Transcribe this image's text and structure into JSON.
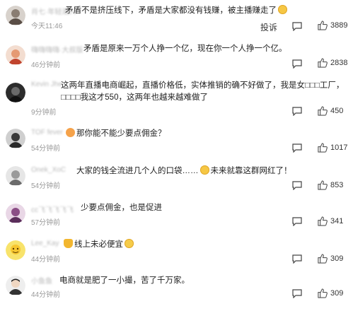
{
  "comments": [
    {
      "user": "肖七·年轻潮人",
      "text_before": "矛盾不是挤压线下，矛盾是大家都没有钱赚，被主播赚走了",
      "emoji_after": "sly-emoji",
      "time": "今天11:46",
      "reply": "投诉",
      "likes": "3889"
    },
    {
      "user": "嗨嗨嗨嗨·大叔版",
      "text_before": "矛盾是原来一万个人挣一个亿，现在你一个人挣一个亿。",
      "time": "46分钟前",
      "likes": "2838"
    },
    {
      "user": "Kevin Jhe",
      "text_before": "这两年直播电商崛起，直播价格低，实体推销的确不好做了，我是女□□□工厂，□□□□我这才550，这两年也越来越难做了",
      "time": "9分钟前",
      "likes": "450"
    },
    {
      "user": "TOF fever",
      "text_before": "那你能不能少要点佣金？",
      "emoji_before": "fire-emoji",
      "time": "54分钟前",
      "likes": "1017"
    },
    {
      "user": "Onek_XoC",
      "text_before": "大家的钱全流进几个人的口袋……",
      "emoji_after": "sly-emoji",
      "text_after": "未来就靠这群网红了！",
      "time": "54分钟前",
      "likes": "853"
    },
    {
      "user": "cc飞飞飞飞飞",
      "text_before": "少要点佣金，也是促进",
      "time": "57分钟前",
      "likes": "341"
    },
    {
      "user": "Lee_Kay",
      "text_before": "线上未必便宜",
      "emoji_before": "crown-emoji",
      "emoji_after": "laugh-emoji",
      "time": "44分钟前",
      "likes": "309"
    },
    {
      "user": "小鱼鱼",
      "text_before": "电商就是肥了一小撮，苦了千万家。",
      "time": "44分钟前",
      "likes": "309"
    }
  ],
  "icons": {
    "reply": "comment-bubble-icon",
    "like": "thumbs-up-icon"
  }
}
